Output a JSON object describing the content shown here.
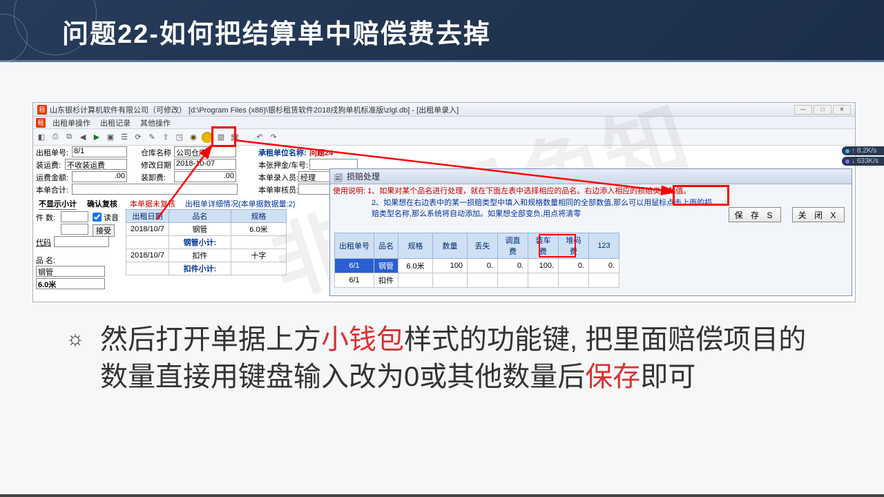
{
  "slide": {
    "title": "问题22-如何把结算单中赔偿费去掉"
  },
  "app": {
    "titlebar": "山东银杉计算机软件有限公司（可修改）   [d:\\Program Files (x86)\\银杉租赁软件2018戌狗单机标准版\\zlgl.db] - [出租单录入]",
    "menus": [
      "出租单操作",
      "出租记录",
      "其他操作"
    ]
  },
  "form": {
    "out_no_label": "出租单号:",
    "out_no": "8/1",
    "warehouse_label": "仓库名称",
    "warehouse": "公司仓库",
    "tenant_label": "承租单位名称:",
    "tenant": "问题24",
    "load_fee_label": "装运费:",
    "load_fee_select": "不收装运费",
    "modify_date_label": "修改日期",
    "modify_date": "2018-10-07",
    "deposit_label": "本张押金/车号:",
    "freight_amt_label": "运费金额:",
    "freight_amt": ".00",
    "load_amt_label": "装卸费:",
    "load_amt": ".00",
    "entry_label": "本单录入员:",
    "entry": "经理",
    "total_label": "本单合计:",
    "audit_label": "本单审核员:",
    "tab1": "不显示小计",
    "tab2": "确认复核",
    "tab3": "本单据未复核",
    "link1": "出租单详细情况(本单据数据量:2)",
    "count_label": "件 数:",
    "read_label": "读音",
    "accept": "接受",
    "code_label": "代码",
    "name_label": "品 名:",
    "name_val": "钢管",
    "spec_val": "6.0米"
  },
  "left_table": {
    "headers": [
      "出租日期",
      "品名",
      "规格"
    ],
    "rows": [
      {
        "date": "2018/10/7",
        "name": "钢管",
        "spec": "6.0米"
      },
      {
        "sub": "钢管小计:"
      },
      {
        "date": "2018/10/7",
        "name": "扣件",
        "spec": "十字"
      },
      {
        "sub": "扣件小计:"
      }
    ]
  },
  "dialog": {
    "title": "损赔处理",
    "note_label": "使用说明:",
    "note1": "1、如果对某个品名进行处理，就在下面左表中选择相应的品名。右边添入相应的损赔类型数值。",
    "note2": "2、如果想在右边表中的某一损赔类型中填入和规格数量相同的全部数值,那么可以用鼠标点击上面的损赔类型名称,那么系统将自动添加。如果想全部变负,用点将清零",
    "save": "保 存 S",
    "close": "关 闭 X",
    "tbl": {
      "headers": [
        "出租单号",
        "品名",
        "规格",
        "数量",
        "丢失",
        "调直费",
        "装车费",
        "堆码费",
        "123"
      ],
      "r1": [
        "6/1",
        "钢管",
        "6.0米",
        "100",
        "0.",
        "0.",
        "100.",
        "0.",
        "0."
      ],
      "r2": [
        "6/1",
        "扣件",
        "",
        "",
        "",
        "",
        "",
        "",
        ""
      ]
    }
  },
  "net": {
    "up": "8.2K/s",
    "down": "633K/s"
  },
  "watermark": "非会员免知",
  "instruction": {
    "bullet": "☼",
    "pre1": "然后打开单据上方",
    "hl1": "小钱包",
    "mid1": "样式的功能键, 把里面赔偿项目的数量直接用键盘输入改为0或其他数量后",
    "hl2": "保存",
    "post": "即可"
  }
}
